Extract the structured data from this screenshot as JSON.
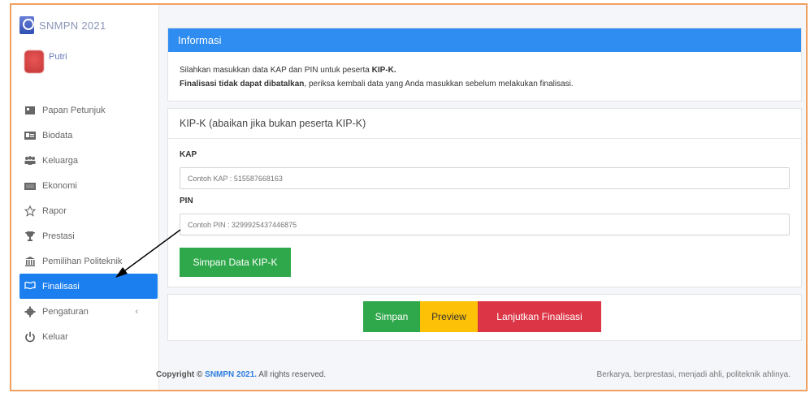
{
  "brand": {
    "title": "SNMPN 2021"
  },
  "user": {
    "name": "Putri"
  },
  "sidebar": {
    "items": [
      {
        "label": "Papan Petunjuk",
        "icon": "dashboard-icon"
      },
      {
        "label": "Biodata",
        "icon": "id-card-icon"
      },
      {
        "label": "Keluarga",
        "icon": "users-icon"
      },
      {
        "label": "Ekonomi",
        "icon": "money-icon"
      },
      {
        "label": "Rapor",
        "icon": "star-icon"
      },
      {
        "label": "Prestasi",
        "icon": "trophy-icon"
      },
      {
        "label": "Pemilihan Politeknik",
        "icon": "institution-icon"
      },
      {
        "label": "Finalisasi",
        "icon": "flag-icon",
        "active": true
      },
      {
        "label": "Pengaturan",
        "icon": "gear-icon",
        "chevron": "‹"
      },
      {
        "label": "Keluar",
        "icon": "power-icon"
      }
    ]
  },
  "info": {
    "title": "Informasi",
    "line1_prefix": "Silahkan masukkan data KAP dan PIN untuk peserta ",
    "line1_bold": "KIP-K.",
    "line2_bold": "Finalisasi tidak dapat dibatalkan",
    "line2_rest": ", periksa kembali data yang Anda masukkan sebelum melakukan finalisasi."
  },
  "kip": {
    "title": "KIP-K (abaikan jika bukan peserta KIP-K)",
    "kap_label": "KAP",
    "kap_placeholder": "Contoh KAP : 515587668163",
    "pin_label": "PIN",
    "pin_placeholder": "Contoh PIN : 3299925437446875",
    "save_label": "Simpan Data KIP-K"
  },
  "actions": {
    "save": "Simpan",
    "preview": "Preview",
    "finalize": "Lanjutkan Finalisasi"
  },
  "footer": {
    "copyright_prefix": "Copyright © ",
    "copyright_brand": "SNMPN 2021.",
    "copyright_rest": " All rights reserved.",
    "tagline": "Berkarya, berprestasi, menjadi ahli, politeknik ahlinya."
  },
  "colors": {
    "primary": "#1b7ff0",
    "success": "#2ea84a",
    "warning": "#fdc107",
    "danger": "#dc3545",
    "frame_border": "#f0a060"
  }
}
